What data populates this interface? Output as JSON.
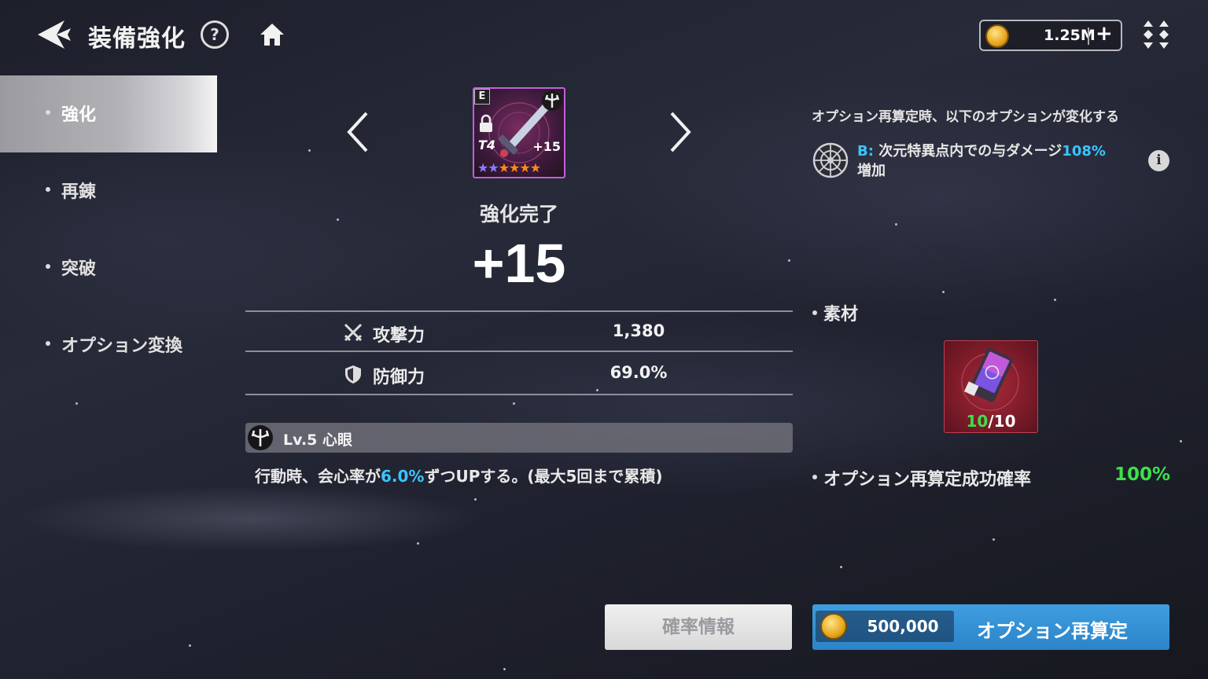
{
  "header": {
    "title": "装備強化",
    "help_label": "?",
    "currency": {
      "value": "1.25M",
      "plus": "+"
    }
  },
  "sidebar": {
    "items": [
      {
        "label": "強化",
        "active": true
      },
      {
        "label": "再錬",
        "active": false
      },
      {
        "label": "突破",
        "active": false
      },
      {
        "label": "オプション変換",
        "active": false
      }
    ]
  },
  "item": {
    "grade": "E",
    "tier": "T4",
    "level": "+15",
    "stars": {
      "blue": "★★",
      "orange": "★★★★"
    }
  },
  "enhance": {
    "status": "強化完了",
    "level": "+15"
  },
  "stats": [
    {
      "label": "攻撃力",
      "value": "1,380",
      "icon": "sword-icon"
    },
    {
      "label": "防御力",
      "value": "69.0%",
      "icon": "shield-icon"
    }
  ],
  "skill": {
    "name": "Lv.5 心眼",
    "desc_before": "行動時、会心率が",
    "desc_highlight": "6.0%",
    "desc_after": "ずつUPする。(最大5回まで累積)"
  },
  "buttons": {
    "probability": "確率情報",
    "recalc": "オプション再算定",
    "cost": "500,000"
  },
  "options": {
    "header": "オプション再算定時、以下のオプションが変化する",
    "lead": "B:",
    "text_before": " 次元特異点内での与ダメージ",
    "highlight": "108%",
    "text_after": "増加",
    "info_label": "i"
  },
  "material": {
    "label": "素材",
    "have": "10",
    "need": "/10"
  },
  "success_rate": {
    "label": "オプション再算定成功確率",
    "value": "100%"
  },
  "colors": {
    "accent_blue": "#3cc4ff",
    "success_green": "#3ce04a",
    "button_blue": "#2c84c8"
  }
}
